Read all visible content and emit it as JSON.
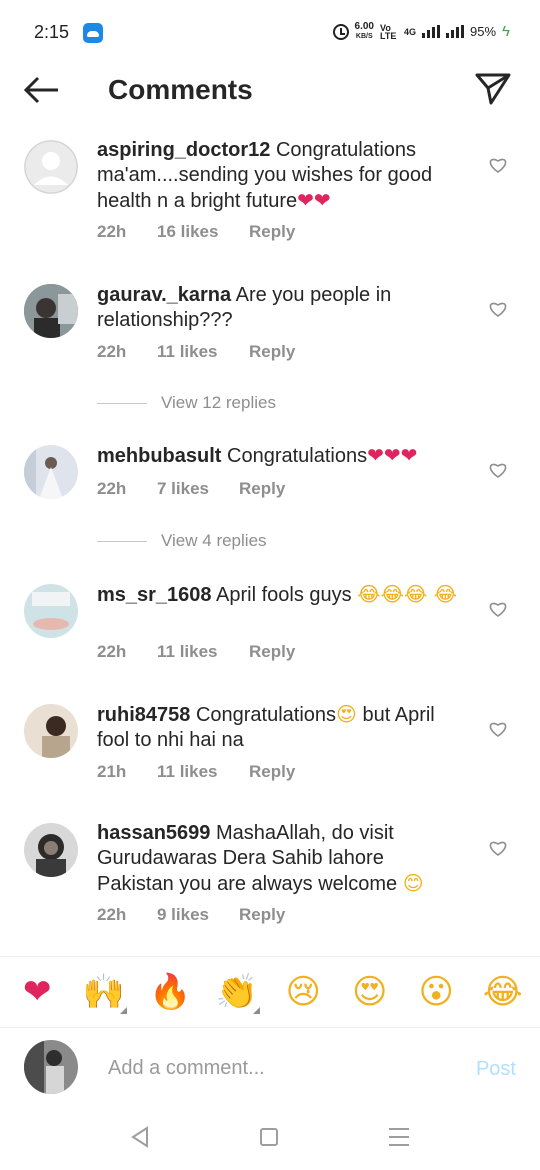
{
  "status_bar": {
    "time": "2:15",
    "speed_value": "6.00",
    "speed_unit": "KB/S",
    "volte": "Vo LTE",
    "network": "4G",
    "battery": "95%"
  },
  "header": {
    "title": "Comments",
    "back_icon": "arrow-left-icon",
    "share_icon": "send-icon"
  },
  "comments": [
    {
      "username": "aspiring_doctor12",
      "text": "Congratulations ma'am....sending you wishes for good health n a bright future",
      "emojis": "❤❤",
      "time": "22h",
      "likes": "16 likes",
      "reply": "Reply"
    },
    {
      "username": "gaurav._karna",
      "text": "Are you people in relationship???",
      "emojis": "",
      "time": "22h",
      "likes": "11 likes",
      "reply": "Reply"
    },
    {
      "username": "mehbubasult",
      "text": "Congratulations",
      "emojis": "❤❤❤",
      "time": "22h",
      "likes": "7 likes",
      "reply": "Reply"
    },
    {
      "username": "ms_sr_1608",
      "text": "April fools guys",
      "emojis": "😂😂😂 😂",
      "time": "22h",
      "likes": "11 likes",
      "reply": "Reply"
    },
    {
      "username": "ruhi84758",
      "text_before": "Congratulations",
      "emoji_mid": "😍",
      "text": "but April fool to nhi hai na",
      "time": "21h",
      "likes": "11 likes",
      "reply": "Reply"
    },
    {
      "username": "hassan5699",
      "text": "MashaAllah, do visit Gurudawaras Dera Sahib lahore Pakistan you are always welcome",
      "emojis": "😊",
      "time": "22h",
      "likes": "9 likes",
      "reply": "Reply"
    }
  ],
  "view_replies": [
    {
      "label": "View 12 replies"
    },
    {
      "label": "View 4 replies"
    }
  ],
  "reactions": [
    "❤",
    "🙌",
    "🔥",
    "👏",
    "😢",
    "😍",
    "😮",
    "😂"
  ],
  "composer": {
    "placeholder": "Add a comment...",
    "post_label": "Post"
  }
}
